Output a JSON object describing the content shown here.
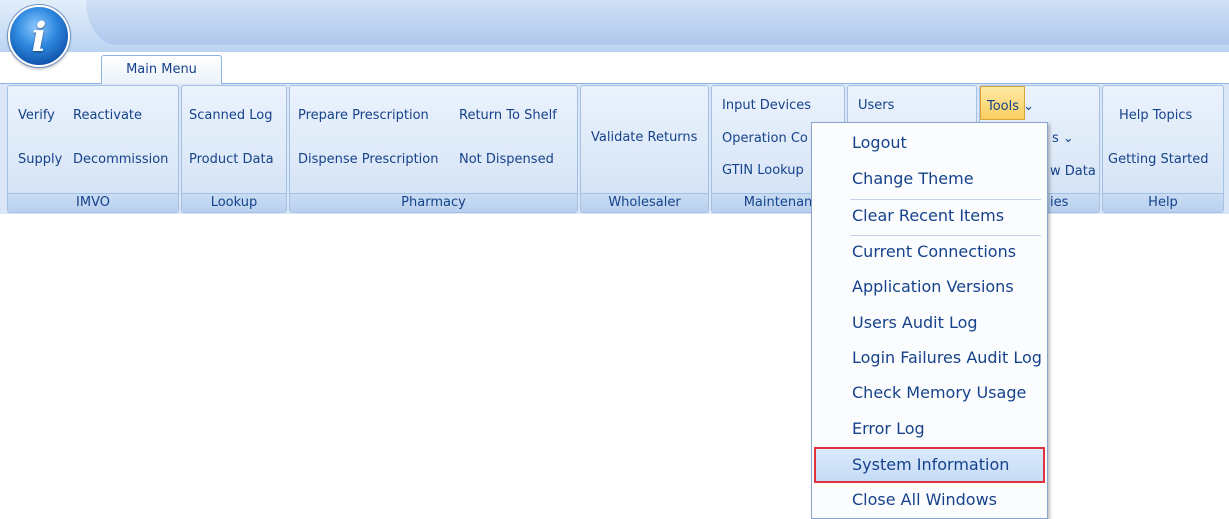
{
  "app": {
    "orb_icon": "info-icon",
    "orb_glyph": "i"
  },
  "tabs": [
    {
      "label": "Main Menu"
    }
  ],
  "ribbon": {
    "groups": [
      {
        "label": "IMVO",
        "items": [
          "Verify",
          "Reactivate",
          "Supply",
          "Decommission"
        ]
      },
      {
        "label": "Lookup",
        "items": [
          "Scanned Log",
          "Product Data"
        ]
      },
      {
        "label": "Pharmacy",
        "items": [
          "Prepare Prescription",
          "Return To Shelf",
          "Dispense Prescription",
          "Not Dispensed"
        ]
      },
      {
        "label": "Wholesaler",
        "items": [
          "Validate Returns"
        ]
      },
      {
        "label": "Maintenan",
        "items": [
          "Input Devices",
          "Operation Co",
          "GTIN Lookup"
        ]
      },
      {
        "label": "",
        "items": [
          "Users"
        ]
      },
      {
        "label": "ies",
        "items": [
          "Tools ⌄",
          "s ⌄",
          "w Data"
        ]
      },
      {
        "label": "Help",
        "items": [
          "Help Topics",
          "Getting Started"
        ]
      }
    ]
  },
  "tools_menu": {
    "items": [
      "Logout",
      "Change Theme",
      "Clear Recent Items",
      "Current Connections",
      "Application Versions",
      "Users Audit Log",
      "Login Failures Audit Log",
      "Check Memory Usage",
      "Error Log",
      "System Information",
      "Close All Windows"
    ],
    "highlighted": "System Information"
  },
  "colors": {
    "text": "#15428b",
    "highlight_border": "#e0313f",
    "ribbon_bg": "#dbe7f6"
  }
}
